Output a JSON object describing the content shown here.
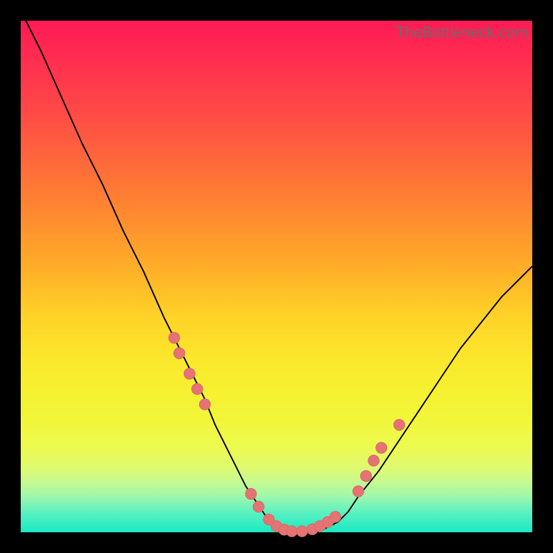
{
  "watermark": "TheBottleneck.com",
  "colors": {
    "frame": "#000000",
    "curve": "#000000",
    "dot": "#e57373",
    "gradient_top": "#ff1a54",
    "gradient_mid": "#ffd328",
    "gradient_bottom": "#18e9c4"
  },
  "chart_data": {
    "type": "line",
    "title": "",
    "xlabel": "",
    "ylabel": "",
    "xlim": [
      0,
      100
    ],
    "ylim": [
      0,
      100
    ],
    "grid": false,
    "series": [
      {
        "name": "curve",
        "x": [
          0,
          4,
          8,
          12,
          16,
          20,
          24,
          28,
          30,
          32,
          34,
          36,
          38,
          40,
          42,
          44,
          46,
          48,
          50,
          52,
          54,
          56,
          58,
          60,
          62,
          64,
          66,
          70,
          74,
          78,
          82,
          86,
          90,
          94,
          98,
          100
        ],
        "y": [
          102,
          94,
          85,
          76,
          68,
          59,
          51,
          42,
          38,
          34,
          30,
          26,
          21,
          17,
          13,
          9,
          6,
          3,
          1,
          0,
          0,
          0,
          0,
          1,
          2,
          4,
          7,
          12,
          18,
          24,
          30,
          36,
          41,
          46,
          50,
          52
        ]
      }
    ],
    "markers": [
      {
        "x": 30,
        "y": 38
      },
      {
        "x": 31,
        "y": 35
      },
      {
        "x": 33,
        "y": 31
      },
      {
        "x": 34.5,
        "y": 28
      },
      {
        "x": 36,
        "y": 25
      },
      {
        "x": 45,
        "y": 7.5
      },
      {
        "x": 46.5,
        "y": 5
      },
      {
        "x": 48.5,
        "y": 2.5
      },
      {
        "x": 50,
        "y": 1.2
      },
      {
        "x": 51.5,
        "y": 0.5
      },
      {
        "x": 53,
        "y": 0.2
      },
      {
        "x": 55,
        "y": 0.2
      },
      {
        "x": 57,
        "y": 0.6
      },
      {
        "x": 58.5,
        "y": 1.2
      },
      {
        "x": 60,
        "y": 2
      },
      {
        "x": 61.5,
        "y": 3
      },
      {
        "x": 66,
        "y": 8
      },
      {
        "x": 67.5,
        "y": 11
      },
      {
        "x": 69,
        "y": 14
      },
      {
        "x": 70.5,
        "y": 16.5
      },
      {
        "x": 74,
        "y": 21
      }
    ]
  }
}
